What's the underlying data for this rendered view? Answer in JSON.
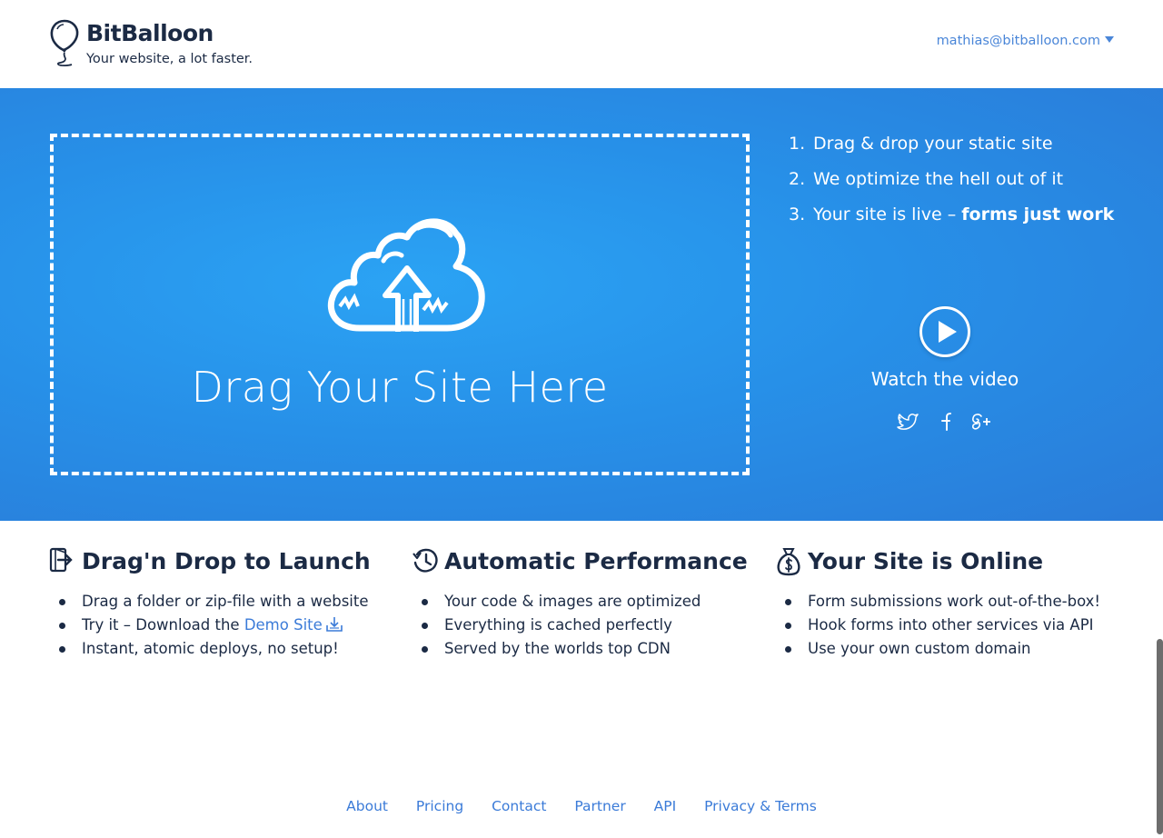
{
  "header": {
    "brand": "BitBalloon",
    "tagline": "Your website, a lot faster.",
    "user_email": "mathias@bitballoon.com"
  },
  "hero": {
    "drop_label": "Drag Your Site Here",
    "steps": [
      {
        "num": "1.",
        "text": "Drag & drop your static site",
        "bold": ""
      },
      {
        "num": "2.",
        "text": "We optimize the hell out of it",
        "bold": ""
      },
      {
        "num": "3.",
        "text": "Your site is live – ",
        "bold": "forms just work"
      }
    ],
    "watch_label": "Watch the video",
    "social_icons": [
      "twitter-icon",
      "facebook-icon",
      "google-plus-icon"
    ]
  },
  "features": [
    {
      "title": "Drag'n Drop to Launch",
      "icon": "drag-drop-icon",
      "items": [
        {
          "text": "Drag a folder or zip-file with a website"
        },
        {
          "text": "Try it – Download the ",
          "link": "Demo Site"
        },
        {
          "text": "Instant, atomic deploys, no setup!"
        }
      ]
    },
    {
      "title": "Automatic Performance",
      "icon": "history-icon",
      "items": [
        {
          "text": "Your code & images are optimized"
        },
        {
          "text": "Everything is cached perfectly"
        },
        {
          "text": "Served by the worlds top CDN"
        }
      ]
    },
    {
      "title": "Your Site is Online",
      "icon": "money-bag-icon",
      "items": [
        {
          "text": "Form submissions work out-of-the-box!"
        },
        {
          "text": "Hook forms into other services via API"
        },
        {
          "text": "Use your own custom domain"
        }
      ]
    }
  ],
  "footer": {
    "links": [
      "About",
      "Pricing",
      "Contact",
      "Partner",
      "API",
      "Privacy & Terms"
    ]
  },
  "colors": {
    "hero_blue": "#2790e8",
    "navy_text": "#1b2a44",
    "link_blue": "#3b7bd8"
  }
}
